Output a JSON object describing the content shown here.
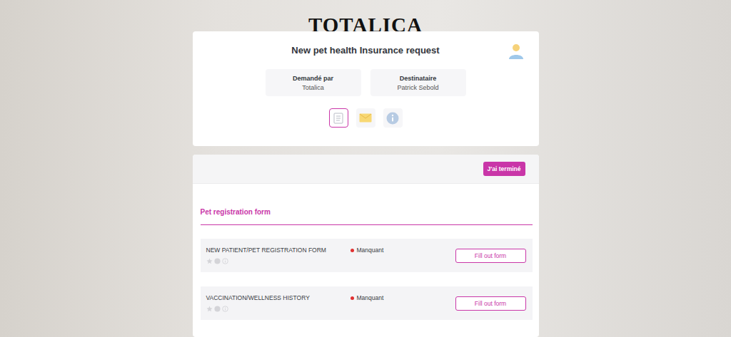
{
  "logo": "TOTALICA",
  "request": {
    "title": "New pet health Insurance request",
    "parties": [
      {
        "label": "Demandé par",
        "value": "Totalica"
      },
      {
        "label": "Destinataire",
        "value": "Patrick Sebold"
      }
    ],
    "tabs": [
      {
        "kind": "document",
        "selected": true
      },
      {
        "kind": "mail",
        "selected": false
      },
      {
        "kind": "info",
        "selected": false
      }
    ]
  },
  "toolbar": {
    "done_button": "J'ai terminé"
  },
  "section": {
    "title": "Pet registration form",
    "rows": [
      {
        "name": "NEW PATIENT/PET REGISTRATION FORM",
        "status": "Manquant",
        "color": "#e03131",
        "button": "Fill out form"
      },
      {
        "name": "VACCINATION/WELLNESS HISTORY",
        "status": "Manquant",
        "color": "#e03131",
        "button": "Fill out form"
      }
    ]
  }
}
